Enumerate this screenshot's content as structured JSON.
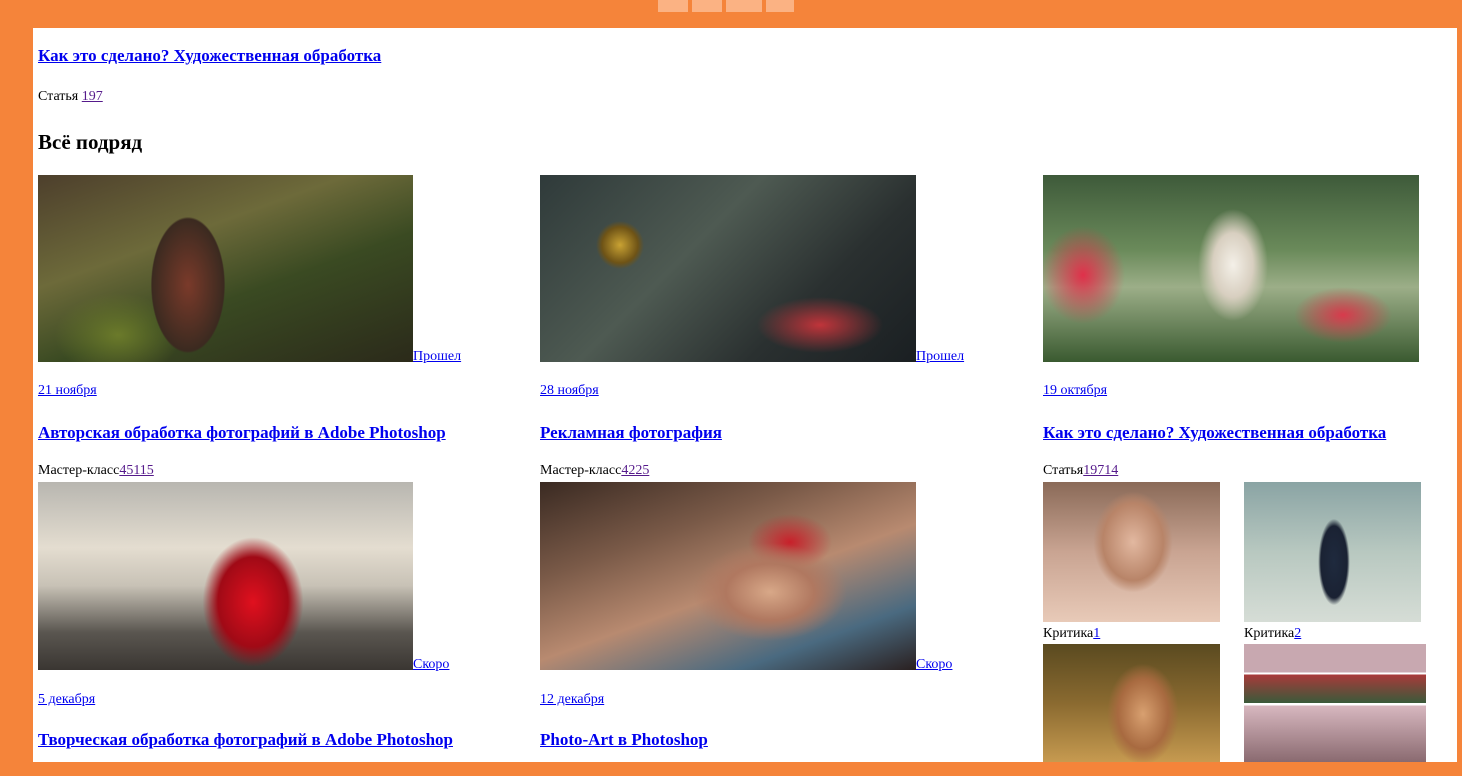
{
  "header": {
    "title": "Как это сделано? Художественная обработка",
    "meta_type": "Статья",
    "meta_count": "197"
  },
  "section_title": "Всё подряд",
  "cards": [
    {
      "status": "Прошел",
      "date": "21 ноября",
      "title": "Авторская обработка фотографий в Adobe Photoshop",
      "type": "Мастер-класс",
      "count": "45115"
    },
    {
      "status": "Прошел",
      "date": "28 ноября",
      "title": "Рекламная фотография",
      "type": "Мастер-класс",
      "count": "4225"
    },
    {
      "status": "",
      "date": "19 октября",
      "title": "Как это сделано? Художественная обработка",
      "type": "Статья",
      "count": "19714"
    },
    {
      "status": "Скоро",
      "date": "5 декабря",
      "title": "Творческая обработка фотографий в Adobe Photoshop"
    },
    {
      "status": "Скоро",
      "date": "12 декабря",
      "title": "Photo-Art в Photoshop"
    }
  ],
  "mini": [
    {
      "type": "Критика",
      "count": "1"
    },
    {
      "type": "Критика",
      "count": "2"
    }
  ],
  "colors": {
    "frame": "#F5843A",
    "link": "#0000EE",
    "visited_link": "#551A8B"
  }
}
